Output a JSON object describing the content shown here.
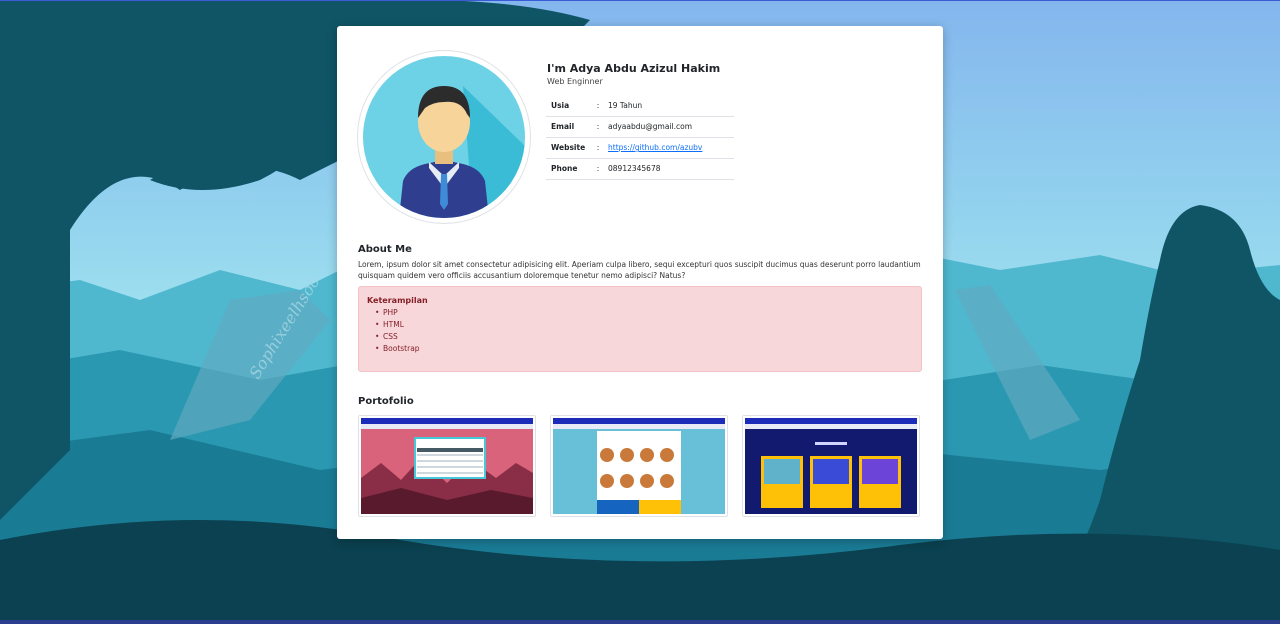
{
  "profile": {
    "name": "I'm Adya Abdu Azizul Hakim",
    "role": "Web Enginner",
    "avatar_icon": "user-avatar-icon",
    "info": [
      {
        "key": "Usia",
        "sep": ":",
        "value": "19 Tahun"
      },
      {
        "key": "Email",
        "sep": ":",
        "value": "adyaabdu@gmail.com"
      },
      {
        "key": "Website",
        "sep": ":",
        "value": "https://github.com/azubv"
      },
      {
        "key": "Phone",
        "sep": ":",
        "value": "08912345678"
      }
    ]
  },
  "about": {
    "heading": "About Me",
    "text": "Lorem, ipsum dolor sit amet consectetur adipisicing elit. Aperiam culpa libero, sequi excepturi quos suscipit ducimus quas deserunt porro laudantium quisquam quidem vero officiis accusantium doloremque tenetur nemo adipisci? Natus?"
  },
  "skills": {
    "title": "Keterampilan",
    "items": [
      "PHP",
      "HTML",
      "CSS",
      "Bootstrap"
    ]
  },
  "portfolio": {
    "heading": "Portofolio",
    "items": [
      {
        "thumbnail": "portfolio-table-app-screenshot"
      },
      {
        "thumbnail": "portfolio-profile-grid-screenshot"
      },
      {
        "thumbnail": "portfolio-project-cards-screenshot"
      }
    ]
  },
  "background": {
    "signature": "Sophixeelhsoo"
  },
  "colors": {
    "alert_bg": "#f8d7da",
    "alert_text": "#842029",
    "link": "#0d6efd",
    "avatar_bg": "#6ed2e6"
  }
}
